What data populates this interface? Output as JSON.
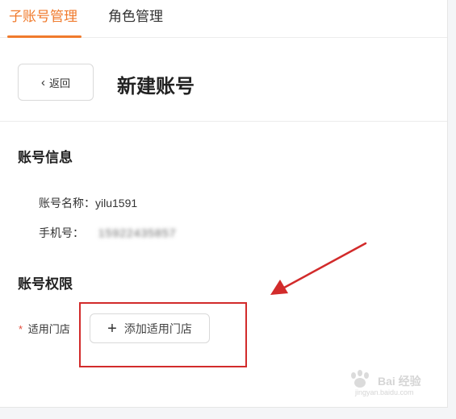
{
  "tabs": [
    {
      "label": "子账号管理",
      "active": true
    },
    {
      "label": "角色管理",
      "active": false
    }
  ],
  "header": {
    "back_label": "返回",
    "title": "新建账号"
  },
  "account_info": {
    "title": "账号信息",
    "name_label": "账号名称：yilu1591",
    "phone_label": "手机号：",
    "phone_value": "15922435857"
  },
  "permissions": {
    "title": "账号权限",
    "required_mark": "*",
    "store_label": "适用门店",
    "add_store_label": "添加适用门店"
  },
  "watermark": {
    "text": "Bai 经验",
    "subtext": "jingyan.baidu.com"
  },
  "colors": {
    "accent": "#f07a2c",
    "annotation": "#d22b2b"
  }
}
